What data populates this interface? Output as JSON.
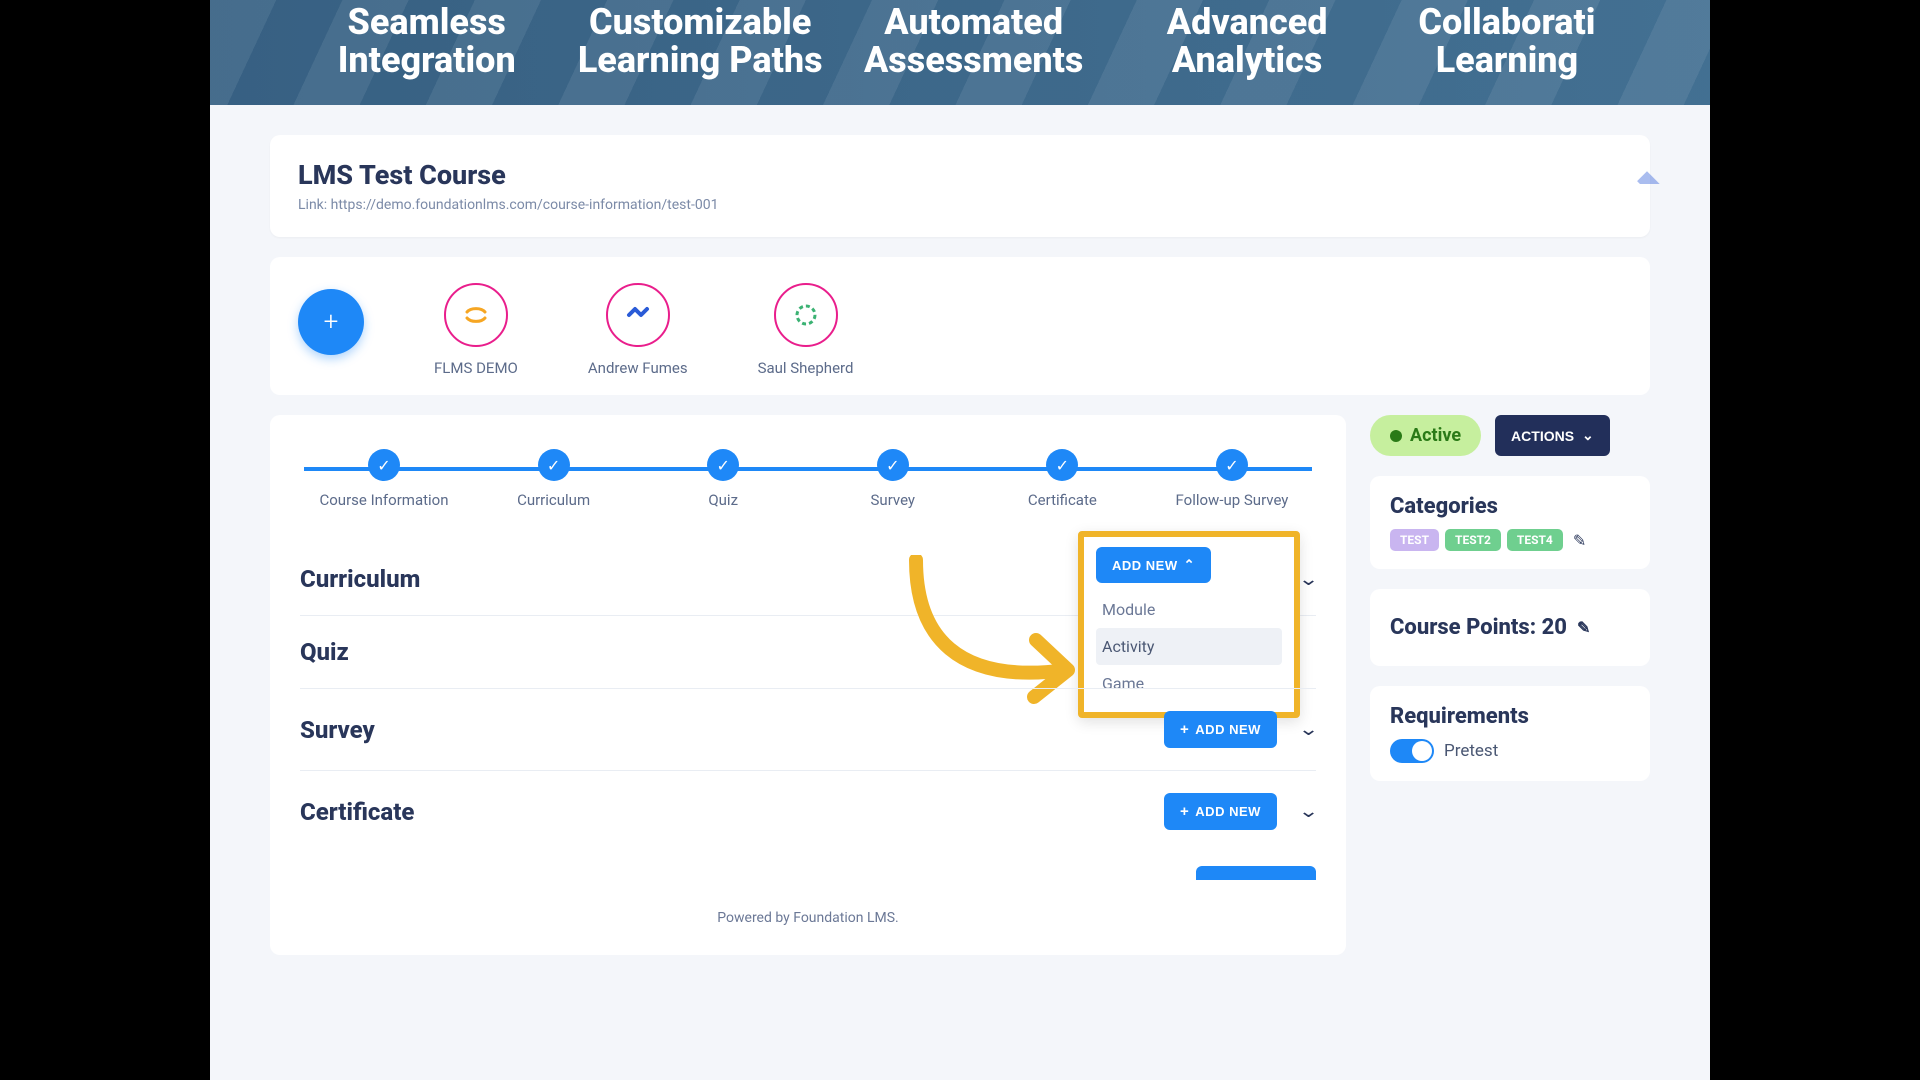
{
  "hero": {
    "items": [
      "Seamless\nIntegration",
      "Customizable\nLearning Paths",
      "Automated\nAssessments",
      "Advanced\nAnalytics",
      "Collaborati\nLearning"
    ]
  },
  "course": {
    "title": "LMS Test Course",
    "link_label": "Link: https://demo.foundationlms.com/course-information/test-001"
  },
  "people": {
    "add_plus": "+",
    "items": [
      {
        "name": "FLMS DEMO"
      },
      {
        "name": "Andrew Fumes"
      },
      {
        "name": "Saul Shepherd"
      }
    ]
  },
  "steps": [
    "Course Information",
    "Curriculum",
    "Quiz",
    "Survey",
    "Certificate",
    "Follow-up Survey"
  ],
  "sections": {
    "curriculum": {
      "title": "Curriculum",
      "add_label": "ADD NEW"
    },
    "quiz": {
      "title": "Quiz"
    },
    "survey": {
      "title": "Survey",
      "add_label": "ADD NEW"
    },
    "certificate": {
      "title": "Certificate",
      "add_label": "ADD NEW"
    }
  },
  "dropdown": {
    "items": [
      "Module",
      "Activity",
      "Game"
    ]
  },
  "footer": "Powered by Foundation LMS.",
  "status": {
    "label": "Active",
    "actions_label": "ACTIONS"
  },
  "categories": {
    "heading": "Categories",
    "tags": [
      "TEST",
      "TEST2",
      "TEST4"
    ]
  },
  "points": {
    "label": "Course Points: 20"
  },
  "requirements": {
    "heading": "Requirements",
    "first": "Pretest"
  },
  "glyphs": {
    "plus": "+",
    "chevron_down": "⌄",
    "chevron_up": "⌃",
    "pencil": "✎"
  }
}
